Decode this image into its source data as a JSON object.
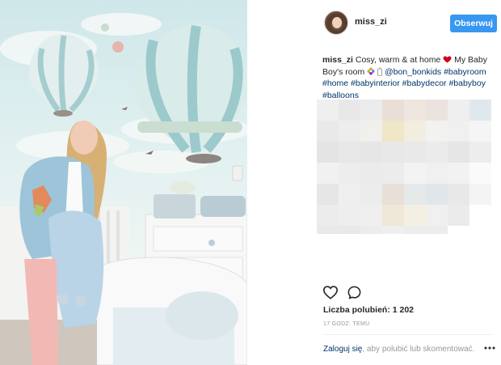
{
  "post": {
    "username": "miss_zi",
    "follow_label": "Obserwuj",
    "caption": {
      "author": "miss_zi",
      "text_1": "Cosy, warm & at home",
      "text_2": "My Baby Boy's room",
      "mention": "@bon_bonkids",
      "tags": [
        "#babyroom",
        "#home",
        "#babyinterior",
        "#babydecor",
        "#babyboy",
        "#balloons"
      ]
    },
    "likes_label": "Liczba polubień: 1 202",
    "time_label": "17 GODZ. TEMU",
    "login_link": "Zaloguj się",
    "login_rest": ", aby polubić lub skomentować."
  },
  "icons": {
    "like": "heart-outline-icon",
    "comment": "speech-bubble-icon",
    "more": "more-dots-icon",
    "caption_heart": "red-heart-emoji",
    "caption_flower": "flower-emoji",
    "caption_bottle": "baby-bottle-emoji"
  },
  "colors": {
    "follow_button": "#3897f0",
    "link": "#003569",
    "muted": "#999999",
    "text": "#262626"
  },
  "blurred_cells": [
    [
      "#efefef",
      "#e8e8e8",
      "#ececec",
      "#eadfd6",
      "#efe6e0",
      "#ebe3df",
      "#efefef",
      "#dfe9ed"
    ],
    [
      "#e9e9e9",
      "#ededed",
      "#f1f0ec",
      "#f0e6c8",
      "#f1ede0",
      "#f2f2f0",
      "#f0f0f0",
      "#f5f5f5"
    ],
    [
      "#e4e4e4",
      "#e7e7e7",
      "#e6e6e6",
      "#e8e8e8",
      "#e9e9e9",
      "#ebebeb",
      "#e6e6e6",
      "#ededed"
    ],
    [
      "#f1f1f1",
      "#ededed",
      "#ebebeb",
      "#ececec",
      "#f3f3f3",
      "#f0f0f0",
      "#f2f2f2",
      "#fafafa"
    ],
    [
      "#e6e6e6",
      "#efefef",
      "#ececec",
      "#e8dfd8",
      "#e6e9ea",
      "#e1e6ea",
      "#e8e8e8",
      "#f4f4f4"
    ],
    [
      "#ececec",
      "#eeeeee",
      "#efefef",
      "#efe8d9",
      "#f3efe2",
      "#f0f0f0",
      "#ebebeb",
      "#ffffff"
    ],
    [
      "#e9e9e9",
      "#e9e9e9",
      "#ececec",
      "#efefef",
      "#ececec",
      "#ececec",
      "#ffffff",
      "#ffffff"
    ]
  ]
}
